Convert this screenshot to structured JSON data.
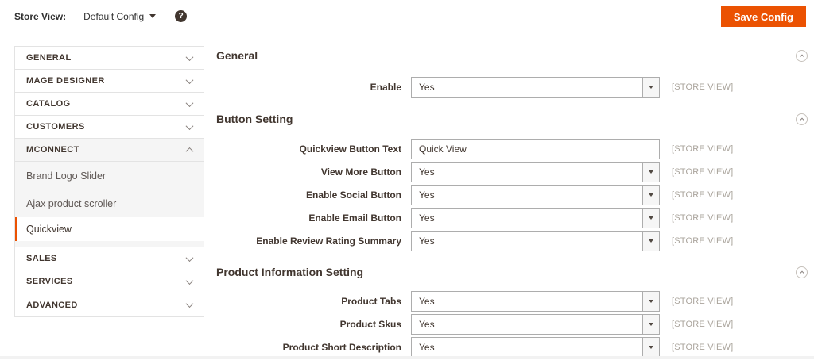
{
  "colors": {
    "accent": "#eb5202",
    "text_dark": "#41362f",
    "muted": "#aaa49c"
  },
  "topbar": {
    "store_view_label": "Store View:",
    "store_view_value": "Default Config",
    "help_icon_glyph": "?",
    "save_button_label": "Save Config"
  },
  "sidebar": {
    "sections_top": [
      {
        "label": "GENERAL"
      },
      {
        "label": "MAGE DESIGNER"
      },
      {
        "label": "CATALOG"
      },
      {
        "label": "CUSTOMERS"
      }
    ],
    "active_section": {
      "label": "MCONNECT"
    },
    "subitems": [
      {
        "label": "Brand Logo Slider"
      },
      {
        "label": "Ajax product scroller"
      },
      {
        "label": "Quickview"
      }
    ],
    "sections_bottom": [
      {
        "label": "SALES"
      },
      {
        "label": "SERVICES"
      },
      {
        "label": "ADVANCED"
      }
    ]
  },
  "main": {
    "scope_label": "[STORE VIEW]",
    "sections": [
      {
        "title": "General",
        "fields": [
          {
            "label": "Enable",
            "type": "select",
            "value": "Yes"
          }
        ]
      },
      {
        "title": "Button Setting",
        "fields": [
          {
            "label": "Quickview Button Text",
            "type": "text",
            "value": "Quick View"
          },
          {
            "label": "View More Button",
            "type": "select",
            "value": "Yes"
          },
          {
            "label": "Enable Social Button",
            "type": "select",
            "value": "Yes"
          },
          {
            "label": "Enable Email Button",
            "type": "select",
            "value": "Yes"
          },
          {
            "label": "Enable Review Rating Summary",
            "type": "select",
            "value": "Yes"
          }
        ]
      },
      {
        "title": "Product Information Setting",
        "fields": [
          {
            "label": "Product Tabs",
            "type": "select",
            "value": "Yes"
          },
          {
            "label": "Product Skus",
            "type": "select",
            "value": "Yes"
          },
          {
            "label": "Product Short Description",
            "type": "select",
            "value": "Yes"
          }
        ]
      }
    ]
  }
}
